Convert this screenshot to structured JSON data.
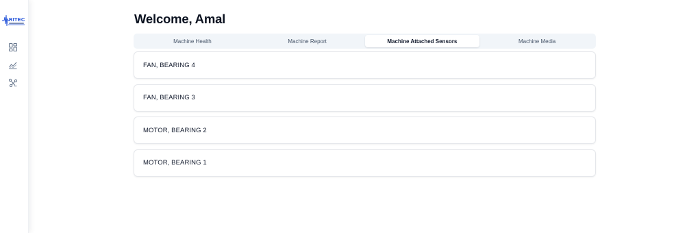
{
  "logo": {
    "text": "RITEC"
  },
  "sidebar": {
    "items": [
      {
        "icon": "dashboard-icon"
      },
      {
        "icon": "trend-chart-icon"
      },
      {
        "icon": "sensor-network-icon"
      }
    ]
  },
  "header": {
    "title": "Welcome, Amal"
  },
  "tabs": [
    {
      "label": "Machine Health",
      "active": false
    },
    {
      "label": "Machine Report",
      "active": false
    },
    {
      "label": "Machine Attached Sensors",
      "active": true
    },
    {
      "label": "Machine Media",
      "active": false
    }
  ],
  "sensors": [
    {
      "name": "FAN, BEARING 4"
    },
    {
      "name": "FAN, BEARING 3"
    },
    {
      "name": "MOTOR, BEARING 2"
    },
    {
      "name": "MOTOR, BEARING 1"
    }
  ],
  "colors": {
    "logo_blue": "#1d4ed8",
    "tab_bar_bg": "#f1f5f9",
    "text_primary": "#0f172a",
    "text_muted": "#475569"
  }
}
